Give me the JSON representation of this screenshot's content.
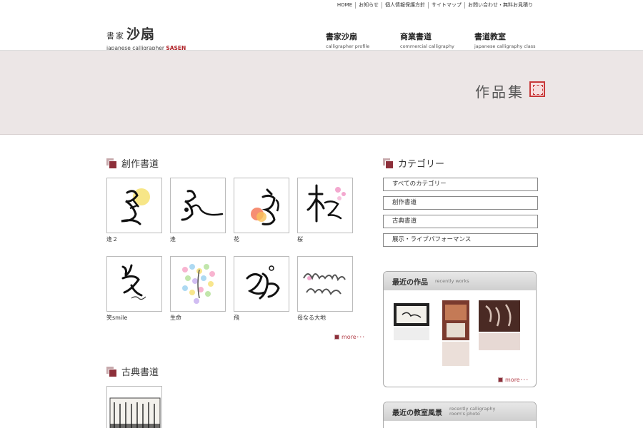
{
  "utility_nav": [
    "HOME",
    "お知らせ",
    "個人情報保護方針",
    "サイトマップ",
    "お問い合わせ・無料お見積り"
  ],
  "logo": {
    "small": "書家",
    "big": "沙扇",
    "sub_prefix": "japanese calligrapher ",
    "sub_accent": "SASEN"
  },
  "main_nav": [
    {
      "jp": "書家沙扇",
      "en": "calligrapher profile"
    },
    {
      "jp": "商業書道",
      "en": "commercial calligraphy"
    },
    {
      "jp": "書道教室",
      "en": "japanese calligraphy class"
    }
  ],
  "hero": {
    "title": "作品集"
  },
  "sections": {
    "creative": {
      "title": "創作書道",
      "more": "more･･･"
    },
    "classic": {
      "title": "古典書道"
    },
    "category": {
      "title": "カテゴリー"
    }
  },
  "works": [
    {
      "caption": "逢２",
      "icon": "calligraphy-artwork"
    },
    {
      "caption": "逢",
      "icon": "calligraphy-artwork"
    },
    {
      "caption": "花",
      "icon": "calligraphy-artwork"
    },
    {
      "caption": "桜",
      "icon": "calligraphy-artwork"
    },
    {
      "caption": "笑smile",
      "icon": "calligraphy-artwork"
    },
    {
      "caption": "生命",
      "icon": "calligraphy-artwork"
    },
    {
      "caption": "飛",
      "icon": "calligraphy-artwork"
    },
    {
      "caption": "母なる大地",
      "icon": "calligraphy-artwork"
    }
  ],
  "categories": [
    "すべてのカテゴリー",
    "創作書道",
    "古典書道",
    "展示・ライブパフォーマンス"
  ],
  "recent_works": {
    "jp": "最近の作品",
    "en": "recently works",
    "more": "more･･･"
  },
  "recent_class": {
    "jp": "最近の教室風景",
    "en_line1": "recently calligraphy",
    "en_line2": "room's photo"
  },
  "colors": {
    "accent": "#8d2f3a",
    "hero_bg": "#ece6e6",
    "seal": "#c8393a"
  }
}
